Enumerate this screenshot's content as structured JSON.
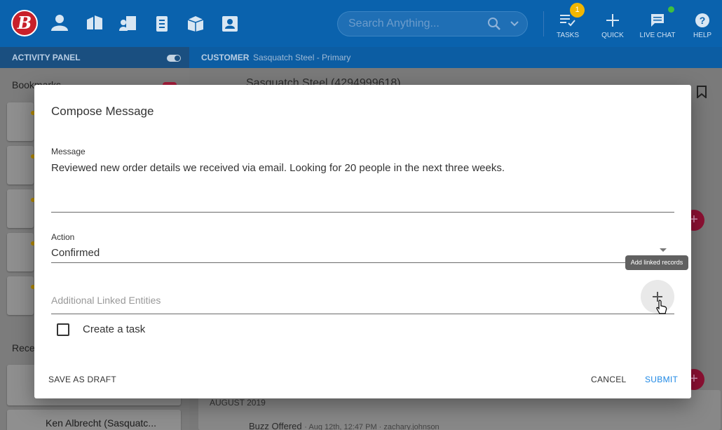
{
  "app": {
    "logo_letter": "B",
    "search_placeholder": "Search Anything...",
    "tasks_label": "TASKS",
    "tasks_count": "1",
    "quick_label": "QUICK",
    "live_chat_label": "LIVE CHAT",
    "help_label": "HELP",
    "activity_panel_title": "ACTIVITY PANEL",
    "customer_label": "CUSTOMER",
    "customer_name": "Sasquatch Steel - Primary",
    "bookmarks_title": "Bookmarks",
    "recent_title": "Rece",
    "recent_item": "Ken Albrecht (Sasquatc...",
    "record_title": "Sasquatch Steel (4294999618)",
    "timeline_month": "AUGUST 2019",
    "timeline_entry": "Buzz Offered",
    "timeline_meta": "· Aug 12th, 12:47 PM · zachary.johnson"
  },
  "dialog": {
    "title": "Compose Message",
    "message_label": "Message",
    "message_value": "Reviewed new order details we received via email. Looking for 20 people in the next three weeks.",
    "action_label": "Action",
    "action_value": "Confirmed",
    "tooltip": "Add linked records",
    "linked_placeholder": "Additional Linked Entities",
    "create_task_label": "Create a task",
    "create_task_checked": false,
    "save_draft": "SAVE AS DRAFT",
    "cancel": "CANCEL",
    "submit": "SUBMIT"
  },
  "colors": {
    "header_blue": "#0a62ad",
    "submit_blue": "#1e88e5",
    "logo_red": "#c8202a",
    "badge_yellow": "#f2b600"
  }
}
